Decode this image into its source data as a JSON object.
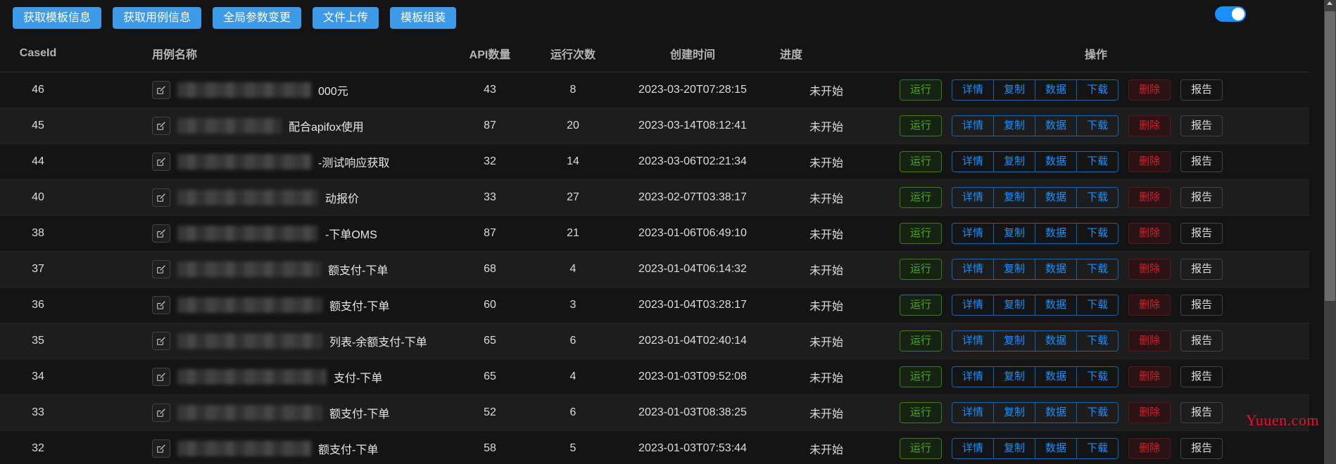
{
  "toolbar": {
    "buttons": [
      {
        "label": "获取模板信息",
        "name": "fetch-template-info"
      },
      {
        "label": "获取用例信息",
        "name": "fetch-case-info"
      },
      {
        "label": "全局参数变更",
        "name": "global-param-change"
      },
      {
        "label": "文件上传",
        "name": "file-upload"
      },
      {
        "label": "模板组装",
        "name": "template-assemble"
      }
    ],
    "toggle": {
      "name": "mode-toggle",
      "state": "on"
    }
  },
  "table": {
    "headers": {
      "case_id": "CaseId",
      "case_name": "用例名称",
      "api_count": "API数量",
      "run_count": "运行次数",
      "create_time": "创建时间",
      "progress": "进度",
      "operation": "操作"
    },
    "row_actions": {
      "run": "运行",
      "detail": "详情",
      "copy": "复制",
      "data": "数据",
      "download": "下载",
      "delete": "删除",
      "report": "报告"
    },
    "rows": [
      {
        "case_id": "46",
        "name_suffix": "000元",
        "redact_width": 190,
        "api_count": "43",
        "run_count": "8",
        "create_time": "2023-03-20T07:28:15",
        "progress": "未开始"
      },
      {
        "case_id": "45",
        "name_suffix": "配合apifox使用",
        "redact_width": 148,
        "api_count": "87",
        "run_count": "20",
        "create_time": "2023-03-14T08:12:41",
        "progress": "未开始"
      },
      {
        "case_id": "44",
        "name_suffix": "-测试响应获取",
        "redact_width": 190,
        "api_count": "32",
        "run_count": "14",
        "create_time": "2023-03-06T02:21:34",
        "progress": "未开始"
      },
      {
        "case_id": "40",
        "name_suffix": "动报价",
        "redact_width": 200,
        "api_count": "33",
        "run_count": "27",
        "create_time": "2023-02-07T03:38:17",
        "progress": "未开始"
      },
      {
        "case_id": "38",
        "name_suffix": "-下单OMS",
        "redact_width": 200,
        "api_count": "87",
        "run_count": "21",
        "create_time": "2023-01-06T06:49:10",
        "progress": "未开始"
      },
      {
        "case_id": "37",
        "name_suffix": "额支付-下单",
        "redact_width": 204,
        "api_count": "68",
        "run_count": "4",
        "create_time": "2023-01-04T06:14:32",
        "progress": "未开始"
      },
      {
        "case_id": "36",
        "name_suffix": "额支付-下单",
        "redact_width": 206,
        "api_count": "60",
        "run_count": "3",
        "create_time": "2023-01-04T03:28:17",
        "progress": "未开始"
      },
      {
        "case_id": "35",
        "name_suffix": "列表-余额支付-下单",
        "redact_width": 206,
        "api_count": "65",
        "run_count": "6",
        "create_time": "2023-01-04T02:40:14",
        "progress": "未开始"
      },
      {
        "case_id": "34",
        "name_suffix": "支付-下单",
        "redact_width": 212,
        "api_count": "65",
        "run_count": "4",
        "create_time": "2023-01-03T09:52:08",
        "progress": "未开始"
      },
      {
        "case_id": "33",
        "name_suffix": "额支付-下单",
        "redact_width": 206,
        "api_count": "52",
        "run_count": "6",
        "create_time": "2023-01-03T08:38:25",
        "progress": "未开始"
      },
      {
        "case_id": "32",
        "name_suffix": "额支付-下单",
        "redact_width": 190,
        "api_count": "58",
        "run_count": "5",
        "create_time": "2023-01-03T07:53:44",
        "progress": "未开始"
      }
    ]
  },
  "watermark": {
    "text": "Yuuen.com"
  }
}
